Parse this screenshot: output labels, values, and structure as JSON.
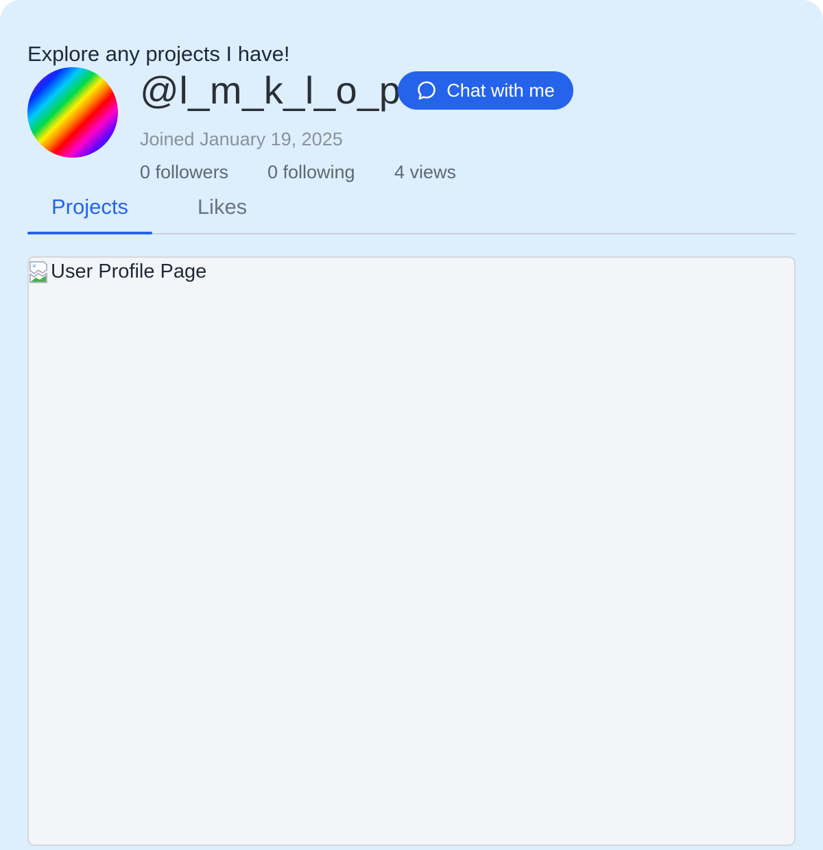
{
  "profile": {
    "bio": "Explore any projects I have!",
    "username": "@l_m_k_l_o_p",
    "joined": "Joined January 19, 2025",
    "stats": {
      "followers": "0 followers",
      "following": "0 following",
      "views": "4 views"
    }
  },
  "actions": {
    "chat_label": "Chat with me",
    "chat_icon": "speech-bubble-icon"
  },
  "tabs": [
    {
      "label": "Projects",
      "active": true
    },
    {
      "label": "Likes",
      "active": false
    }
  ],
  "content": {
    "image_alt": "User Profile Page",
    "image_icon": "broken-image-icon"
  },
  "colors": {
    "background": "#ddeefc",
    "accent": "#2563eb",
    "frame": "#f3f5f8"
  }
}
